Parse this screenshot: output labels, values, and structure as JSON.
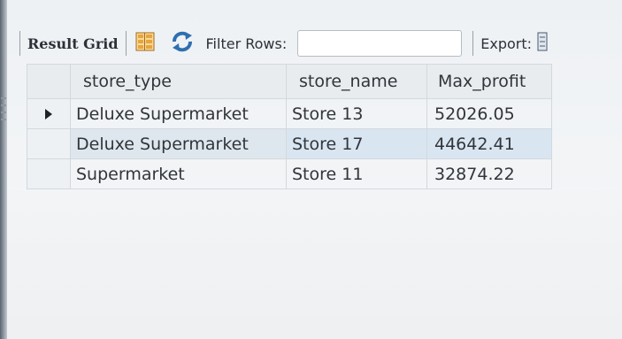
{
  "toolbar": {
    "result_grid_label": "Result Grid",
    "filter_label": "Filter Rows:",
    "filter_value": "",
    "export_label": "Export:"
  },
  "grid": {
    "columns": [
      "store_type",
      "store_name",
      "Max_profit"
    ],
    "rows": [
      {
        "store_type": "Deluxe Supermarket",
        "store_name": "Store 13",
        "max_profit": "52026.05"
      },
      {
        "store_type": "Deluxe Supermarket",
        "store_name": "Store 17",
        "max_profit": "44642.41"
      },
      {
        "store_type": "Supermarket",
        "store_name": "Store 11",
        "max_profit": "32874.22"
      }
    ],
    "current_row": 1
  },
  "icons": {
    "grid_view": "grid-view-icon",
    "refresh": "refresh-icon",
    "export": "export-icon",
    "row_pointer": "row-pointer-icon"
  },
  "colors": {
    "selected_row": "#d9e6f1",
    "header_bg": "#e9ecef",
    "refresh_blue": "#2f6fb0",
    "grid_icon_orange": "#e8a53a"
  }
}
